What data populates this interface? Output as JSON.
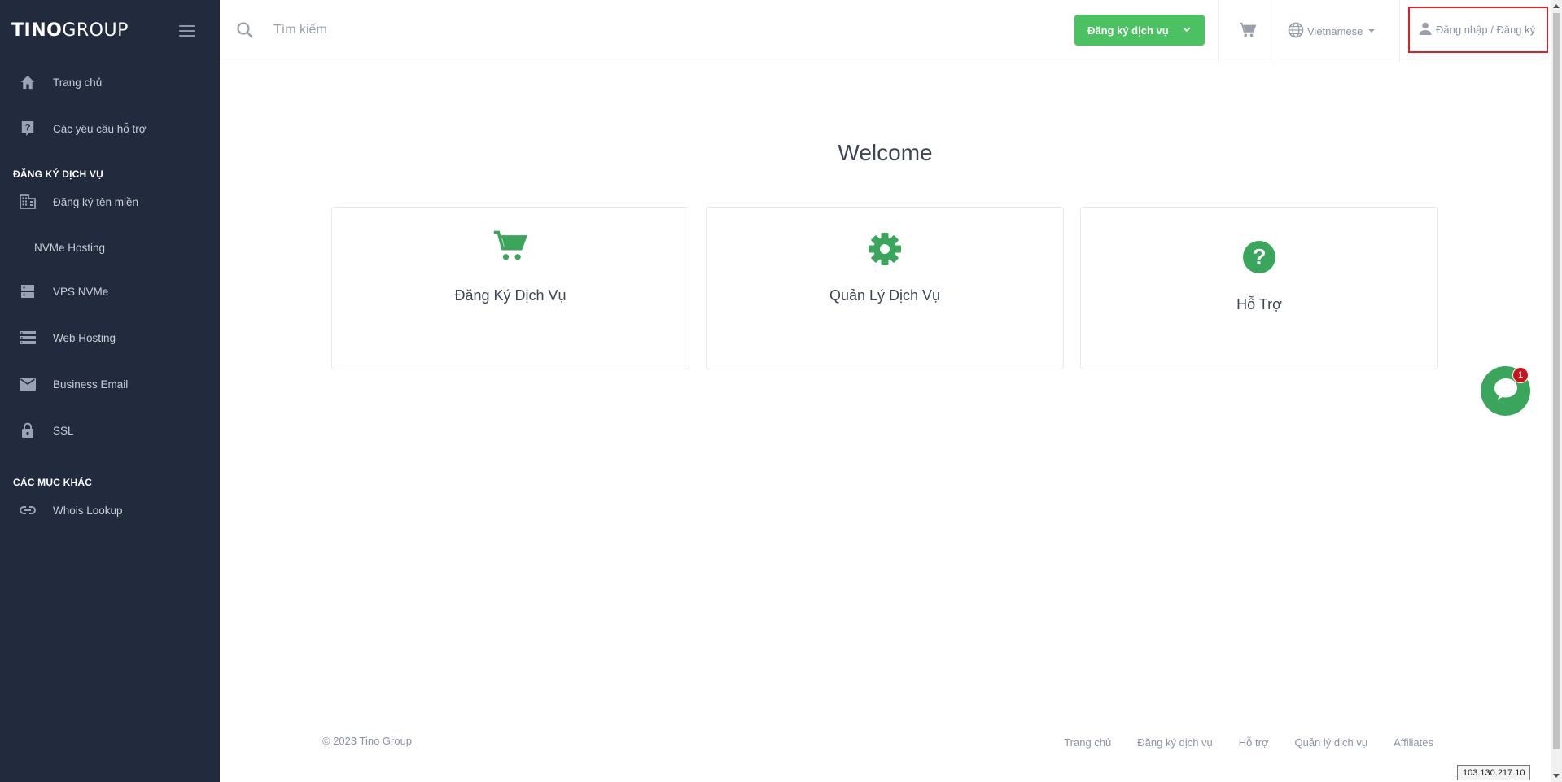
{
  "sidebar": {
    "logo_left": "TINO",
    "logo_right": "GROUP",
    "items": [
      {
        "label": "Trang chủ",
        "icon": "home-icon"
      },
      {
        "label": "Các yêu cầu hỗ trợ",
        "icon": "help-box-icon"
      },
      {
        "label": "Đăng ký tên miền",
        "icon": "domain-icon"
      },
      {
        "label": "NVMe Hosting",
        "icon": ""
      },
      {
        "label": "VPS NVMe",
        "icon": "server-icon"
      },
      {
        "label": "Web Hosting",
        "icon": "list-icon"
      },
      {
        "label": "Business Email",
        "icon": "mail-icon"
      },
      {
        "label": "SSL",
        "icon": "lock-icon"
      },
      {
        "label": "Whois Lookup",
        "icon": "link-icon"
      }
    ],
    "section_services": "ĐĂNG KÝ DỊCH VỤ",
    "section_other": "CÁC MỤC KHÁC"
  },
  "header": {
    "search_placeholder": "Tìm kiếm",
    "register_button": "Đăng ký dịch vụ",
    "language": "Vietnamese",
    "login": "Đăng nhập / Đăng ký"
  },
  "main": {
    "welcome": "Welcome",
    "cards": [
      {
        "title": "Đăng Ký Dịch Vụ",
        "icon": "cart-icon"
      },
      {
        "title": "Quản Lý Dịch Vụ",
        "icon": "gear-icon"
      },
      {
        "title": "Hỗ Trợ",
        "icon": "question-icon"
      }
    ]
  },
  "chat": {
    "badge_count": "1"
  },
  "footer": {
    "copyright": "© 2023 Tino Group",
    "links": [
      "Trang chủ",
      "Đăng ký dịch vụ",
      "Hỗ trợ",
      "Quản lý dịch vụ",
      "Affiliates"
    ]
  },
  "ip_address": "103.130.217.10",
  "colors": {
    "sidebar_bg": "#222b3d",
    "accent_green": "#4cc162",
    "icon_green": "#3aa65b",
    "highlight_red": "#e01e26"
  }
}
